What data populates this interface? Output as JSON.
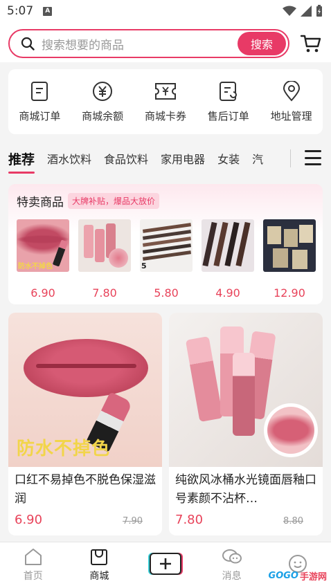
{
  "status": {
    "time": "5:07"
  },
  "search": {
    "placeholder": "搜索想要的商品",
    "button": "搜索"
  },
  "quick_actions": [
    {
      "label": "商城订单",
      "icon": "order-doc-icon"
    },
    {
      "label": "商城余额",
      "icon": "yen-coin-icon"
    },
    {
      "label": "商城卡券",
      "icon": "coupon-ticket-icon"
    },
    {
      "label": "售后订单",
      "icon": "after-sale-icon"
    },
    {
      "label": "地址管理",
      "icon": "location-pin-icon"
    }
  ],
  "tabs": [
    "推荐",
    "酒水饮料",
    "食品饮料",
    "家用电器",
    "女装",
    "汽"
  ],
  "special": {
    "title": "特卖商品",
    "tag": "大牌补贴，爆品大放价",
    "items": [
      {
        "price": "6.90",
        "overlay": "防水不掉色"
      },
      {
        "price": "7.80",
        "overlay": ""
      },
      {
        "price": "5.80",
        "overlay": "5"
      },
      {
        "price": "4.90",
        "overlay": ""
      },
      {
        "price": "12.90",
        "overlay": ""
      }
    ]
  },
  "products": [
    {
      "name": "口红不易掉色不脱色保湿滋润",
      "price": "6.90",
      "old_price": "7.90",
      "overlay": "防水不掉色"
    },
    {
      "name": "纯欲风冰桶水光镜面唇釉口号素颜不沾杯…",
      "price": "7.80",
      "old_price": "8.80",
      "overlay": ""
    }
  ],
  "bottom_nav": [
    {
      "label": "首页",
      "icon": "home-icon"
    },
    {
      "label": "商城",
      "icon": "shop-bag-icon"
    },
    {
      "label": "",
      "icon": "plus-icon"
    },
    {
      "label": "消息",
      "icon": "chat-icon"
    },
    {
      "label": "",
      "icon": "profile-face-icon"
    }
  ],
  "watermark": {
    "logo": "GOGO",
    "site": "手游网"
  },
  "colors": {
    "accent": "#e83a66",
    "price": "#e8435a"
  }
}
